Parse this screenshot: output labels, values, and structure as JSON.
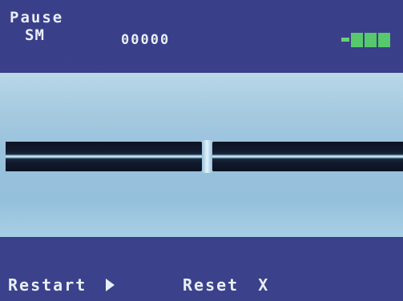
{
  "status": {
    "mode": "Pause",
    "fiber_type": "SM",
    "counter": "00000"
  },
  "battery": {
    "icon": "battery-icon",
    "level_cells": 3,
    "max_cells": 3,
    "color": "#56c96c"
  },
  "view": {
    "background_top": "#b9d8e8",
    "background_bottom": "#95c0dc",
    "fiber_color": "#0d1424",
    "core_highlight_color": "#d8f1fb"
  },
  "softkeys": {
    "restart_label": "Restart",
    "restart_icon": "play-icon",
    "reset_label": "Reset",
    "reset_icon_text": "X"
  },
  "theme": {
    "background": "#3a3f8a",
    "text_color": "#e8eef6"
  }
}
